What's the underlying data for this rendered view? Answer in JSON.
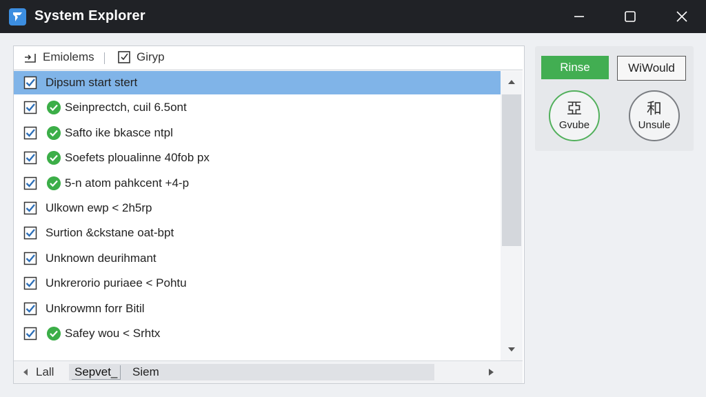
{
  "window": {
    "title": "System Explorer",
    "icon": "app-logo-icon",
    "controls": [
      "minimize-icon",
      "maximize-icon",
      "close-icon"
    ]
  },
  "list_header": {
    "col1": "Emiolems",
    "col2": "Girуp"
  },
  "rows": [
    {
      "text": "Dipsum start stert",
      "checked": true,
      "status_icon": false,
      "selected": true
    },
    {
      "text": "Seinprectch, cuil 6.5ont",
      "checked": true,
      "status_icon": true,
      "selected": false
    },
    {
      "text": "Safto ike bkasce ntpl",
      "checked": true,
      "status_icon": true,
      "selected": false
    },
    {
      "text": "Soefets ploualinne 40fob px",
      "checked": true,
      "status_icon": true,
      "selected": false
    },
    {
      "text": "5-n atom pahkcent +4-p",
      "checked": true,
      "status_icon": true,
      "selected": false
    },
    {
      "text": "Ulkown ewp < 2h5rp",
      "checked": true,
      "status_icon": false,
      "selected": false
    },
    {
      "text": "Surtion &ckstane oat-bpt",
      "checked": true,
      "status_icon": false,
      "selected": false
    },
    {
      "text": "Unknown deurihmant",
      "checked": true,
      "status_icon": false,
      "selected": false
    },
    {
      "text": "Unkrerorio puriaee < Pohtu",
      "checked": true,
      "status_icon": false,
      "selected": false
    },
    {
      "text": "Unkrowmn forr Bitil",
      "checked": true,
      "status_icon": false,
      "selected": false
    },
    {
      "text": "Safey wou < Srhtx",
      "checked": true,
      "status_icon": true,
      "selected": false
    }
  ],
  "bottom_bar": {
    "left_label": "Lall",
    "tab1": "Sepvet_",
    "tab2": "Siem"
  },
  "actions": {
    "rinse_label": "Rinse",
    "would_label": "WiWould",
    "round1_glyph": "亞",
    "round1_label": "Gvube",
    "round2_glyph": "和",
    "round2_label": "Unsule"
  },
  "colors": {
    "titlebar": "#202226",
    "selection": "#80b4e8",
    "check_blue": "#2d6fb8",
    "ok_green": "#3cae48",
    "rinse_green": "#42ae52"
  }
}
